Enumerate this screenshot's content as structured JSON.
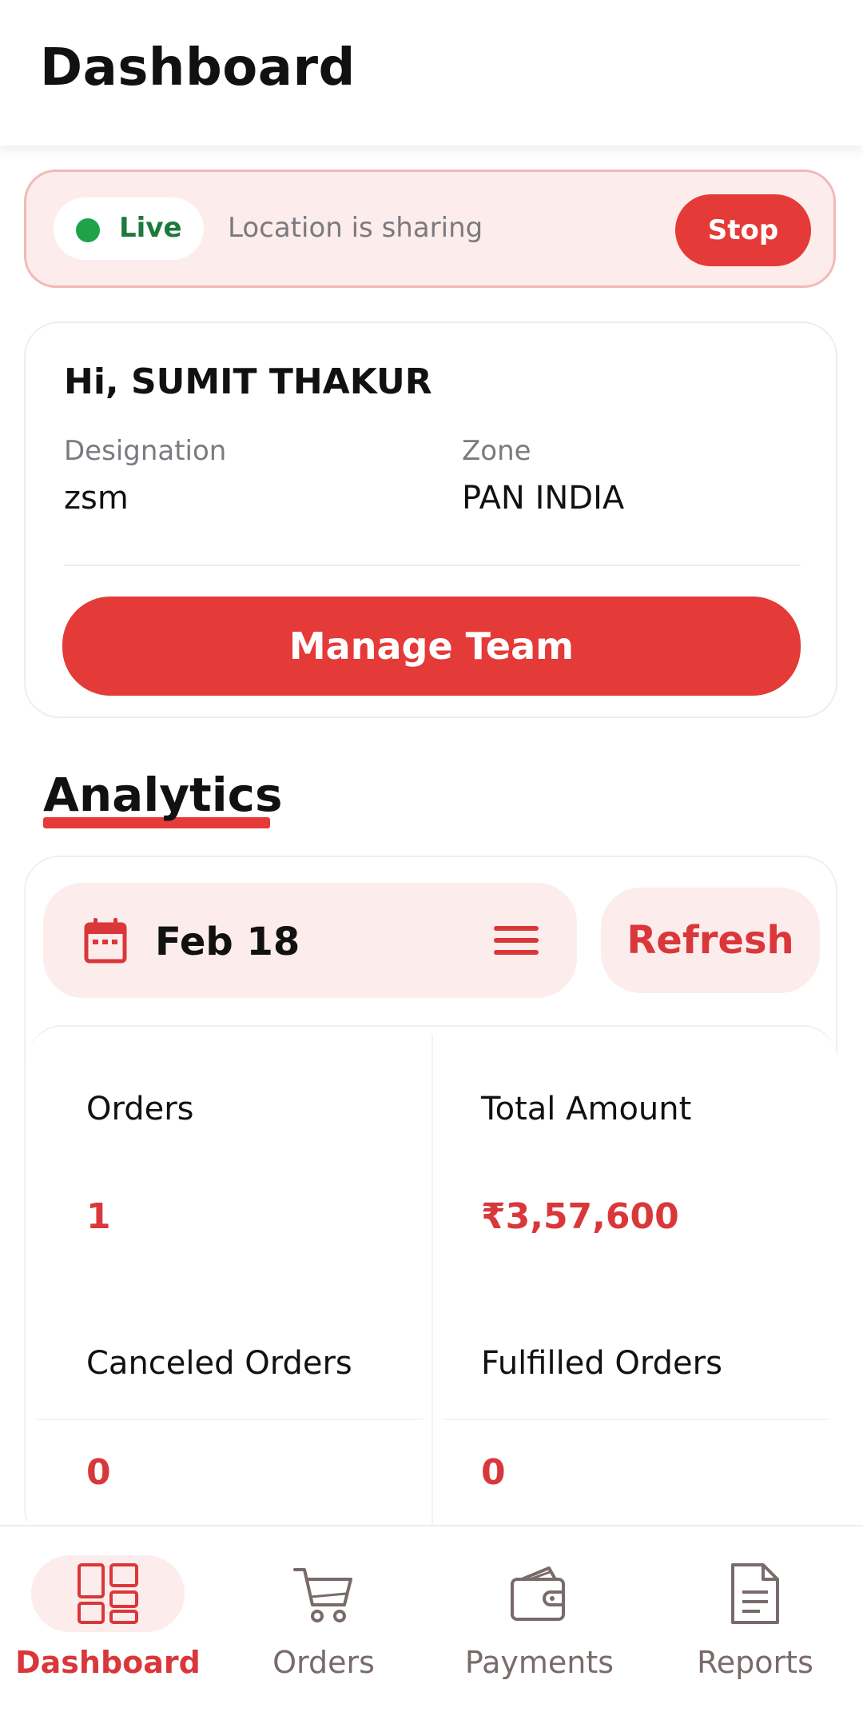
{
  "header": {
    "title": "Dashboard"
  },
  "live_banner": {
    "status_label": "Live",
    "message": "Location is sharing",
    "stop_label": "Stop",
    "status_color": "#1fa34a"
  },
  "profile": {
    "greeting": "Hi, SUMIT THAKUR",
    "designation_label": "Designation",
    "designation_value": "zsm",
    "zone_label": "Zone",
    "zone_value": "PAN INDIA",
    "manage_button": "Manage Team"
  },
  "analytics": {
    "title": "Analytics",
    "date": "Feb 18",
    "refresh_label": "Refresh",
    "stats": [
      {
        "label": "Orders",
        "value": "1"
      },
      {
        "label": "Total Amount",
        "value": "₹3,57,600"
      },
      {
        "label": "Canceled Orders",
        "value": "0"
      },
      {
        "label": "Fulfilled Orders",
        "value": "0"
      }
    ]
  },
  "bottom_nav": {
    "items": [
      {
        "label": "Dashboard",
        "icon": "dashboard-grid-icon",
        "active": true
      },
      {
        "label": "Orders",
        "icon": "cart-icon",
        "active": false
      },
      {
        "label": "Payments",
        "icon": "wallet-icon",
        "active": false
      },
      {
        "label": "Reports",
        "icon": "document-icon",
        "active": false
      }
    ]
  },
  "colors": {
    "accent": "#e43a38",
    "accent_soft": "#fdecec",
    "muted_text": "#7a7a80"
  }
}
